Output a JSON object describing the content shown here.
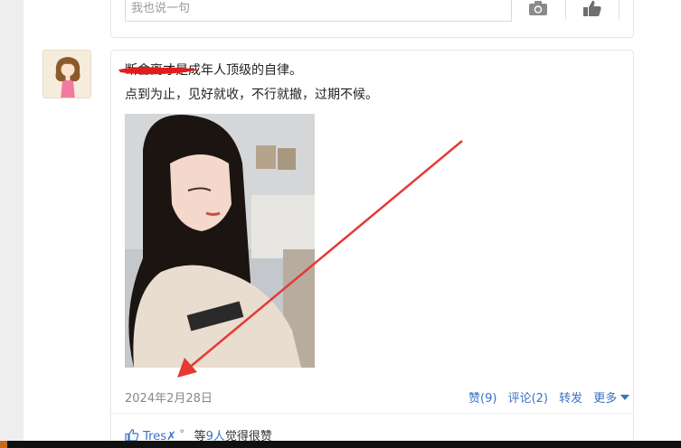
{
  "comment_box": {
    "placeholder": "我也说一句"
  },
  "post": {
    "author_fragment": "",
    "line1": "断舍离才是成年人顶级的自律。",
    "line2": "点到为止，见好就收，不行就撤，过期不候。",
    "date": "2024年2月28日",
    "actions": {
      "like": "赞(9)",
      "comment": "评论(2)",
      "share": "转发",
      "more": "更多"
    },
    "likes": {
      "name": "Tres",
      "name_mark": "✗",
      "name_dot": "˚",
      "prefix": "等",
      "count": "9人",
      "suffix": "觉得很赞"
    }
  },
  "colors": {
    "link": "#3b71c4",
    "annotation": "#e53935"
  }
}
